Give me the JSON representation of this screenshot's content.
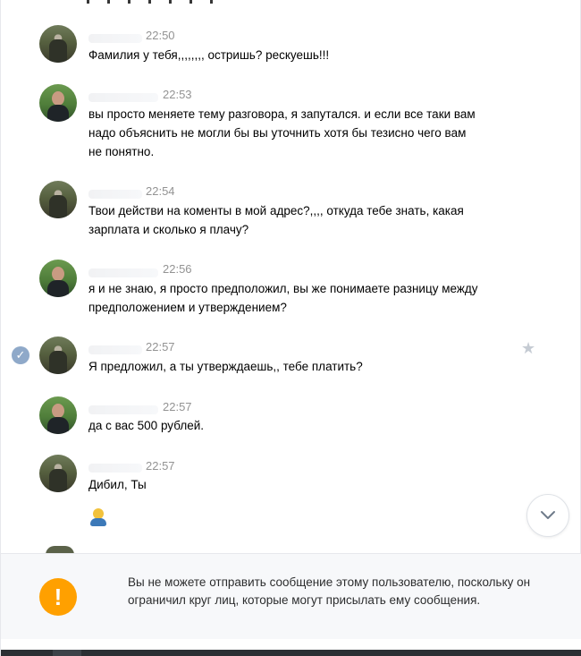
{
  "messages": [
    {
      "time": "22:50",
      "text": "Фамилия у тебя,,,,,,,, остришь? рескуешь!!!",
      "author": "other"
    },
    {
      "time": "22:53",
      "text": "вы просто меняете тему разговора, я запутался. и если все таки вам надо объяснить не могли бы вы уточнить хотя бы тезисно чего вам не понятно.",
      "author": "self"
    },
    {
      "time": "22:54",
      "text": "Твои действи на коменты в мой адрес?,,,, откуда тебе знать, какая зарплата и сколько я плачу?",
      "author": "other"
    },
    {
      "time": "22:56",
      "text": "я и не знаю, я просто предположил, вы же понимаете разницу между предположением и утверждением?",
      "author": "self"
    },
    {
      "time": "22:57",
      "text": "Я предложил, а ты утверждаешь,, тебе платить?",
      "author": "other",
      "selected": true
    },
    {
      "time": "22:57",
      "text": "да с вас 500 рублей.",
      "author": "self"
    },
    {
      "time": "22:57",
      "text": "Дибил, Ты",
      "author": "other",
      "emoji": "man-yellow-hair-emoji"
    }
  ],
  "icons": {
    "check": "✓",
    "star": "★",
    "scroll_down": "chevron-down-icon",
    "notice": "!"
  },
  "notice": {
    "text": "Вы не можете отправить сообщение этому пользователю, поскольку он ограничил круг лиц, которые могут присылать ему сообщения."
  },
  "colors": {
    "accent": "#ffa000",
    "time": "#939393",
    "check": "#8fa9c9"
  }
}
